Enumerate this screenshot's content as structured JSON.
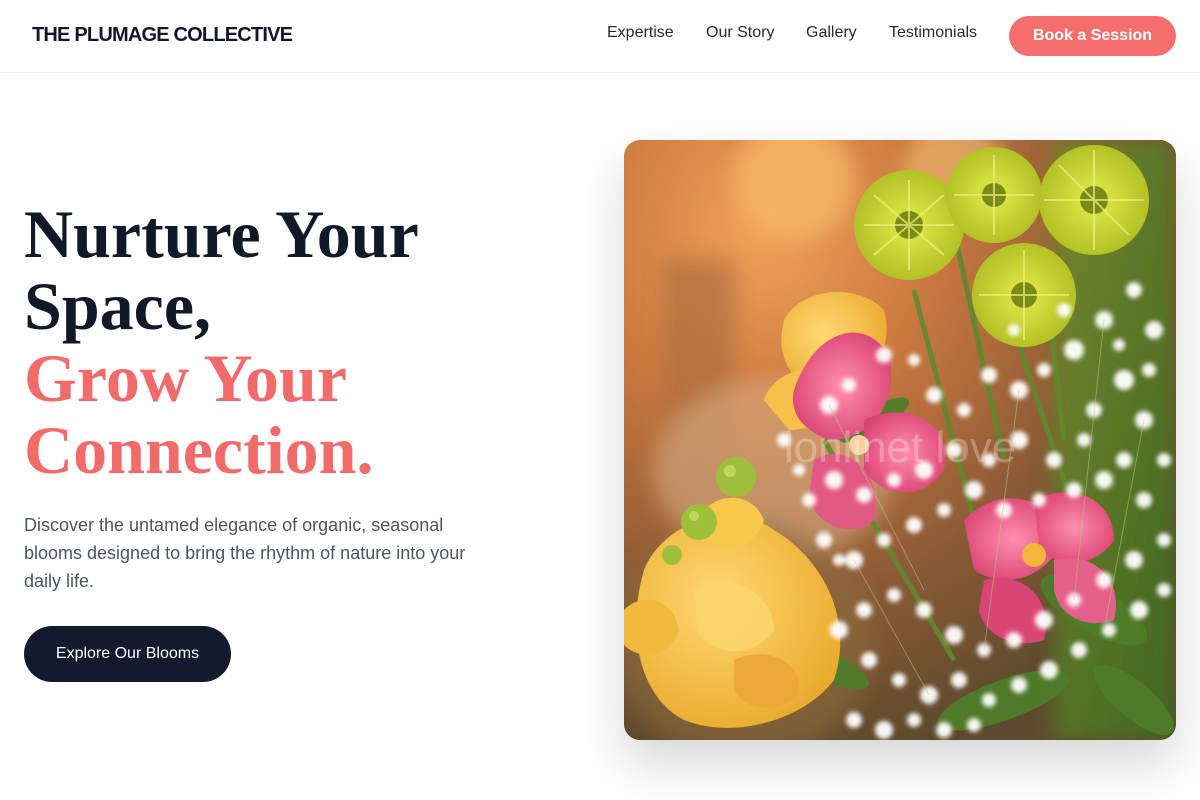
{
  "header": {
    "logo": "THE PLUMAGE COLLECTIVE",
    "nav": [
      {
        "label": "Expertise"
      },
      {
        "label": "Our Story"
      },
      {
        "label": "Gallery"
      },
      {
        "label": "Testimonials"
      }
    ],
    "cta_label": "Book a Session"
  },
  "hero": {
    "title_line1": "Nurture Your",
    "title_line2": "Space,",
    "title_line3": "Grow Your",
    "title_line4": "Connection.",
    "description": "Discover the untamed elegance of organic, seasonal blooms designed to bring the rhythm of nature into your daily life.",
    "button_label": "Explore Our Blooms"
  },
  "image": {
    "watermark": "lonlinet love"
  },
  "colors": {
    "accent": "#f56e6e",
    "dark": "#131a2e",
    "text": "#111827",
    "muted": "#4b5563"
  }
}
